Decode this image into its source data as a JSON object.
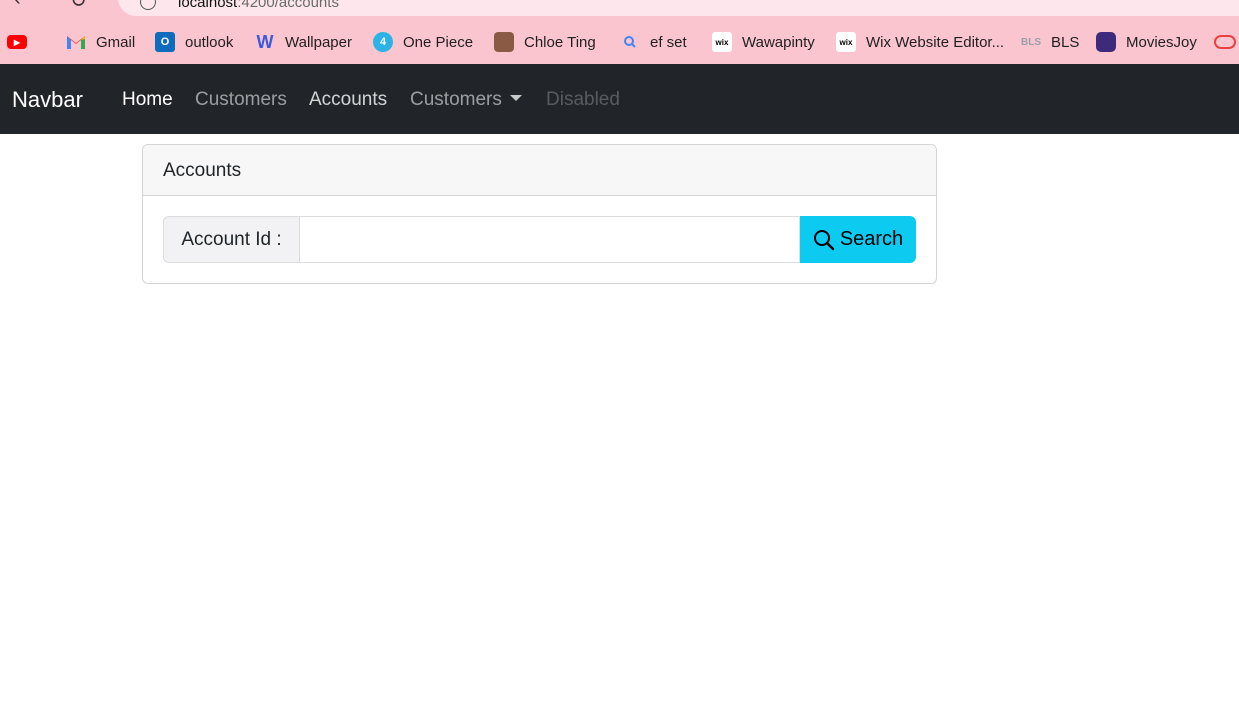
{
  "browser": {
    "url_host": "localhost",
    "url_path": ":4200/accounts",
    "bookmarks": [
      {
        "label": "",
        "icon": "youtube-icon",
        "color": "#ff0000"
      },
      {
        "label": "Gmail",
        "icon": "gmail-icon",
        "color": "#ea4335"
      },
      {
        "label": "outlook",
        "icon": "outlook-icon",
        "color": "#0f6cbd"
      },
      {
        "label": "Wallpaper",
        "icon": "wallpaper-icon",
        "color": "#3b5bdb"
      },
      {
        "label": "One Piece",
        "icon": "one-piece-icon",
        "color": "#2bb3e6"
      },
      {
        "label": "Chloe Ting",
        "icon": "chloe-ting-avatar",
        "color": "#8a5a44"
      },
      {
        "label": "ef set",
        "icon": "search-icon",
        "color": "#4285f4"
      },
      {
        "label": "Wawapinty",
        "icon": "wix-icon",
        "color": "#ffffff"
      },
      {
        "label": "Wix Website Editor...",
        "icon": "wix-icon",
        "color": "#ffffff"
      },
      {
        "label": "BLS",
        "icon": "bls-icon",
        "color": "#9aa0a6"
      },
      {
        "label": "MoviesJoy",
        "icon": "moviesjoy-icon",
        "color": "#3d2a7a"
      }
    ]
  },
  "navbar": {
    "brand": "Navbar",
    "links": [
      "Home",
      "Customers",
      "Accounts",
      "Customers",
      "Disabled"
    ]
  },
  "card": {
    "title": "Accounts",
    "field_label": "Account Id :",
    "field_value": "",
    "button_label": "Search"
  },
  "colors": {
    "navbar_bg": "#212529",
    "button_bg": "#0dcaf0",
    "chrome_bg": "#fbc5d0"
  }
}
